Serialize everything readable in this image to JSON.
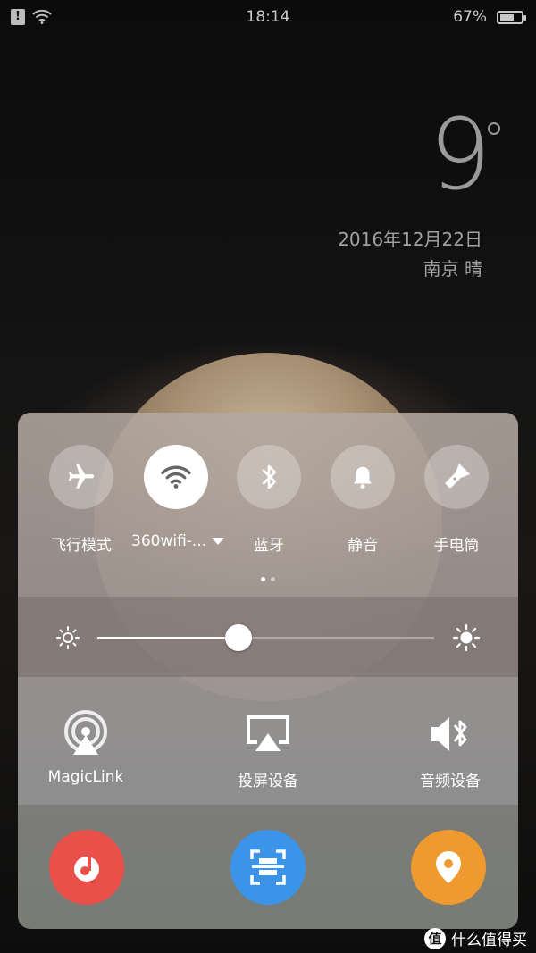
{
  "status_bar": {
    "time": "18:14",
    "battery_percent": "67%",
    "battery_level": 0.67,
    "alert_symbol": "!"
  },
  "lockscreen": {
    "temperature": "9",
    "date": "2016年12月22日",
    "location_weather": "南京   晴"
  },
  "quick_toggles": [
    {
      "label": "飞行模式",
      "icon": "airplane-icon",
      "active": false
    },
    {
      "label": "360wifi-...",
      "icon": "wifi-icon",
      "active": true
    },
    {
      "label": "蓝牙",
      "icon": "bluetooth-icon",
      "active": false
    },
    {
      "label": "静音",
      "icon": "bell-icon",
      "active": false
    },
    {
      "label": "手电筒",
      "icon": "flashlight-icon",
      "active": false
    }
  ],
  "pager": {
    "pages": 2,
    "current": 1
  },
  "brightness": {
    "level": 0.42
  },
  "media": [
    {
      "label": "MagicLink",
      "icon": "magiclink-icon"
    },
    {
      "label": "投屏设备",
      "icon": "screen-cast-icon"
    },
    {
      "label": "音频设备",
      "icon": "bluetooth-audio-icon"
    }
  ],
  "apps": [
    {
      "icon": "music-icon",
      "color": "#e9504a"
    },
    {
      "icon": "scan-icon",
      "color": "#3b94e8"
    },
    {
      "icon": "location-icon",
      "color": "#ef9a2e"
    }
  ],
  "watermark": {
    "badge": "值",
    "text": "什么值得买"
  }
}
